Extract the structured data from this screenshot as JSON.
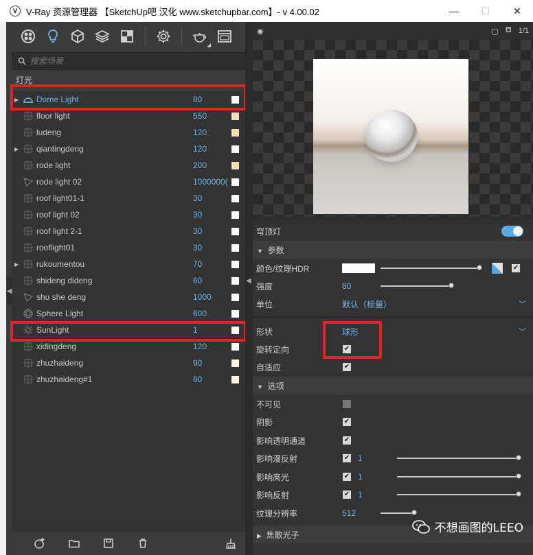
{
  "window": {
    "title": "V-Ray 资源管理器 【SketchUp吧 汉化 www.sketchupbar.com】- v 4.00.02",
    "app_icon": "V",
    "min_glyph": "—",
    "max_glyph": "☐",
    "close_glyph": "✕"
  },
  "toolbar": {
    "icons": [
      "materials-icon",
      "lights-icon",
      "geometry-icon",
      "render-elements-icon",
      "textures-icon",
      "settings-icon",
      "render-teapot-icon",
      "frame-buffer-icon"
    ]
  },
  "search": {
    "placeholder": "搜索场景"
  },
  "section": {
    "title": "灯光"
  },
  "lights": [
    {
      "name": "Dome Light",
      "value": "80",
      "swatch": "#ffffff",
      "type": "dome",
      "expand": true,
      "selected": true
    },
    {
      "name": "floor light",
      "value": "550",
      "swatch": "#f5deb3",
      "type": "rect",
      "expand": false
    },
    {
      "name": "ludeng",
      "value": "120",
      "swatch": "#f5deb3",
      "type": "rect",
      "expand": false
    },
    {
      "name": "qiantingdeng",
      "value": "120",
      "swatch": "#ffffff",
      "type": "rect",
      "expand": true
    },
    {
      "name": "rode light",
      "value": "200",
      "swatch": "#f5deb3",
      "type": "rect",
      "expand": false
    },
    {
      "name": "rode light 02",
      "value": "1000000(",
      "swatch": "#ffffff",
      "type": "spot",
      "expand": false
    },
    {
      "name": "roof light01-1",
      "value": "30",
      "swatch": "#ffffff",
      "type": "rect",
      "expand": false
    },
    {
      "name": "roof light 02",
      "value": "30",
      "swatch": "#ffffff",
      "type": "rect",
      "expand": false
    },
    {
      "name": "roof light 2-1",
      "value": "30",
      "swatch": "#ffffff",
      "type": "rect",
      "expand": false
    },
    {
      "name": "rooflight01",
      "value": "30",
      "swatch": "#ffffff",
      "type": "rect",
      "expand": false
    },
    {
      "name": "rukoumentou",
      "value": "70",
      "swatch": "#ffffff",
      "type": "rect",
      "expand": true
    },
    {
      "name": "shideng dideng",
      "value": "60",
      "swatch": "#ffffff",
      "type": "rect",
      "expand": false
    },
    {
      "name": "shu she deng",
      "value": "1000",
      "swatch": "#ffffff",
      "type": "spot",
      "expand": false
    },
    {
      "name": "Sphere Light",
      "value": "600",
      "swatch": "#ffffff",
      "type": "sphere",
      "expand": false
    },
    {
      "name": "SunLight",
      "value": "1",
      "swatch": "#ffffff",
      "type": "sun",
      "expand": false
    },
    {
      "name": "xidingdeng",
      "value": "120",
      "swatch": "#ffffff",
      "type": "rect",
      "expand": false
    },
    {
      "name": "zhuzhaideng",
      "value": "90",
      "swatch": "#fff8dc",
      "type": "rect",
      "expand": false
    },
    {
      "name": "zhuzhaideng#1",
      "value": "60",
      "swatch": "#fff8dc",
      "type": "rect",
      "expand": false
    }
  ],
  "preview": {
    "ratio": "1/1"
  },
  "props": {
    "dome_title": "穹顶灯",
    "params_header": "参数",
    "color_label": "颜色/纹理HDR",
    "intensity_label": "强度",
    "intensity_value": "80",
    "unit_label": "单位",
    "unit_value": "默认（标量）",
    "shape_label": "形状",
    "shape_value": "球形",
    "rotate_label": "旋转定向",
    "adaptive_label": "自适应",
    "options_header": "选项",
    "invisible_label": "不可见",
    "shadow_label": "阴影",
    "alpha_label": "影响透明通道",
    "diffuse_label": "影响漫反射",
    "diffuse_value": "1",
    "specular_label": "影响高光",
    "specular_value": "1",
    "reflect_label": "影响反射",
    "reflect_value": "1",
    "tex_res_label": "纹理分辨率",
    "tex_res_value": "512",
    "caustics_header": "焦散光子"
  },
  "watermark": {
    "text": "不想画图的LEEO"
  },
  "colors": {
    "accent": "#6fb5e8",
    "highlight_box": "#e02424"
  }
}
